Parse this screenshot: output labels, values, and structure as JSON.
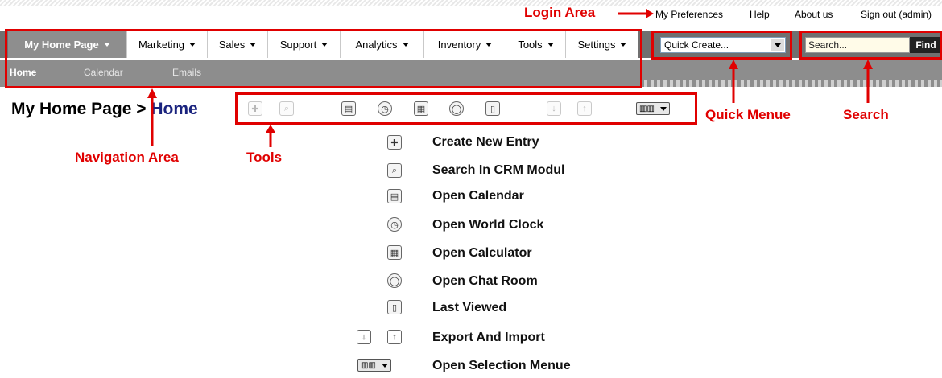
{
  "login": {
    "label": "Login Area",
    "links": [
      "My Preferences",
      "Help",
      "About us",
      "Sign out (admin)"
    ]
  },
  "nav": {
    "items": [
      {
        "label": "My Home Page",
        "active": true
      },
      {
        "label": "Marketing"
      },
      {
        "label": "Sales"
      },
      {
        "label": "Support"
      },
      {
        "label": "Analytics"
      },
      {
        "label": "Inventory"
      },
      {
        "label": "Tools"
      },
      {
        "label": "Settings"
      }
    ],
    "subitems": [
      "Home",
      "Calendar",
      "Emails"
    ]
  },
  "quick_create": {
    "value": "Quick Create..."
  },
  "search": {
    "placeholder": "Search...",
    "button": "Find"
  },
  "page": {
    "title_prefix": "My Home Page",
    "separator": ">",
    "title_current": "Home"
  },
  "annotations": {
    "navigation": "Navigation Area",
    "tools": "Tools",
    "quick_menu": "Quick Menue",
    "search": "Search"
  },
  "legend": [
    {
      "icon": "plus-icon",
      "text": "Create New Entry"
    },
    {
      "icon": "magnifier-icon",
      "text": "Search In CRM Modul"
    },
    {
      "icon": "calendar-icon",
      "text": "Open Calendar"
    },
    {
      "icon": "clock-icon",
      "text": "Open World Clock"
    },
    {
      "icon": "calculator-icon",
      "text": "Open Calculator"
    },
    {
      "icon": "chat-icon",
      "text": "Open Chat Room"
    },
    {
      "icon": "last-viewed-icon",
      "text": "Last Viewed"
    },
    {
      "icon": "export-import-icon",
      "text": "Export And Import"
    },
    {
      "icon": "selection-menu-icon",
      "text": "Open Selection Menue"
    }
  ],
  "colors": {
    "annotation": "#e00000",
    "title_accent": "#1a237e",
    "nav_active": "#8e8e8e"
  }
}
